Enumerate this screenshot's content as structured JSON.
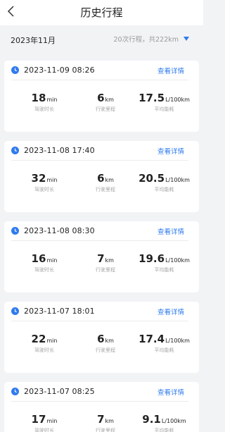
{
  "header": {
    "title": "历史行程",
    "back_icon": "chevron-left-icon"
  },
  "summary": {
    "month": "2023年11月",
    "stats": "20次行程，共222km",
    "accent": "#2f7bef"
  },
  "labels": {
    "duration": "驾驶时长",
    "distance": "行驶里程",
    "consumption": "平均能耗"
  },
  "trips": [
    {
      "datetime": "2023-11-09 08:26",
      "detail": "查看详情",
      "duration": "18",
      "duration_unit": "min",
      "distance": "6",
      "distance_unit": "km",
      "consumption": "17.5",
      "consumption_unit": "L/100km"
    },
    {
      "datetime": "2023-11-08 17:40",
      "detail": "查看详情",
      "duration": "32",
      "duration_unit": "min",
      "distance": "6",
      "distance_unit": "km",
      "consumption": "20.5",
      "consumption_unit": "L/100km"
    },
    {
      "datetime": "2023-11-08 08:30",
      "detail": "查看详情",
      "duration": "16",
      "duration_unit": "min",
      "distance": "7",
      "distance_unit": "km",
      "consumption": "19.6",
      "consumption_unit": "L/100km"
    },
    {
      "datetime": "2023-11-07 18:01",
      "detail": "查看详情",
      "duration": "22",
      "duration_unit": "min",
      "distance": "6",
      "distance_unit": "km",
      "consumption": "17.4",
      "consumption_unit": "L/100km"
    },
    {
      "datetime": "2023-11-07 08:25",
      "detail": "查看详情",
      "duration": "17",
      "duration_unit": "min",
      "distance": "7",
      "distance_unit": "km",
      "consumption": "9.1",
      "consumption_unit": "L/100km"
    }
  ]
}
